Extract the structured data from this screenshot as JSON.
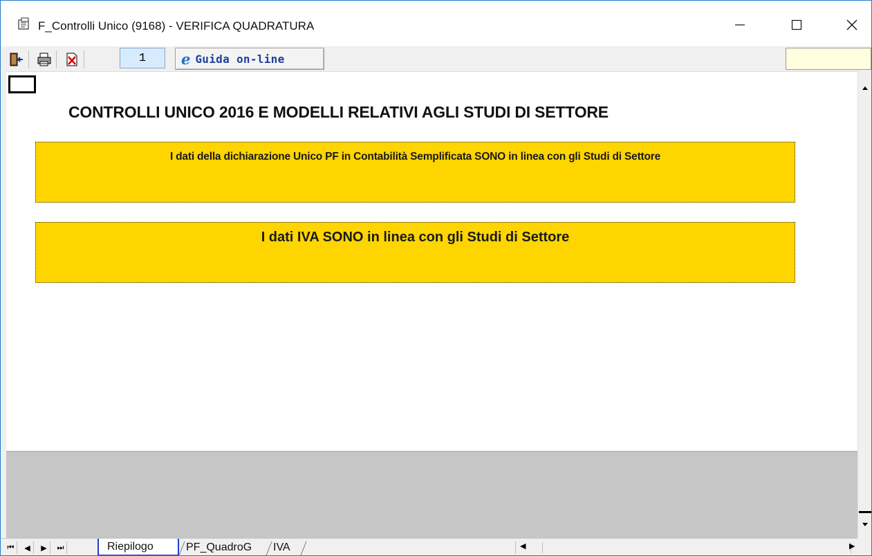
{
  "window": {
    "title": "F_Controlli Unico (9168) - VERIFICA QUADRATURA",
    "minimize_label": "—",
    "maximize_label": "☐",
    "close_label": "✕"
  },
  "toolbar": {
    "page_number": "1",
    "guide_label": "Guida on-line",
    "guide_icon": "e"
  },
  "content": {
    "title": "CONTROLLI UNICO 2016 E MODELLI RELATIVI AGLI STUDI DI SETTORE",
    "message_unico": "I dati della dichiarazione Unico PF in Contabilità Semplificata SONO  in linea con gli Studi di Settore",
    "message_iva": "I dati IVA SONO in linea con gli Studi di Settore"
  },
  "tabs": [
    {
      "label": "Riepilogo",
      "active": true
    },
    {
      "label": "PF_QuadroG",
      "active": false
    },
    {
      "label": "IVA",
      "active": false
    }
  ],
  "colors": {
    "accent": "#1f7ac9",
    "status_box": "#ffd500",
    "page_box": "#d7ebff"
  }
}
